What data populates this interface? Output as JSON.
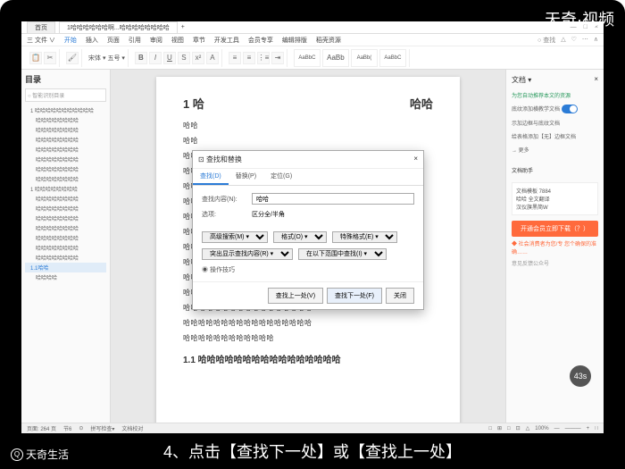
{
  "watermark": "天奇·视频",
  "titlebar": {
    "tab1": "首页",
    "tab2": "1哈哈哈哈哈哈啊...哈哈哈哈哈哈哈哈",
    "add": "+"
  },
  "window_controls": {
    "min": "—",
    "max": "□",
    "close": "×"
  },
  "ribbon": {
    "tabs": [
      "三 文件 ∨",
      "开始",
      "插入",
      "页面",
      "引用",
      "审阅",
      "视图",
      "章节",
      "开发工具",
      "会员专享",
      "编辑排版",
      "稻壳资源"
    ],
    "active_index": 1,
    "right": [
      "○ 查找",
      "△",
      "♡",
      "⋯",
      "∧"
    ]
  },
  "toolbar": {
    "styles": [
      "AaBbC",
      "AaBb(",
      "AaBbC"
    ],
    "style_big": "AaBb"
  },
  "sidebar": {
    "title": "目录",
    "search_placeholder": "智能识别目录",
    "items": [
      {
        "t": "1 哈哈哈哈哈哈哈哈哈哈哈",
        "lvl": 1
      },
      {
        "t": "哈哈哈哈哈哈哈哈",
        "lvl": 2
      },
      {
        "t": "哈哈哈哈哈哈哈哈",
        "lvl": 2
      },
      {
        "t": "哈哈哈哈哈哈哈哈",
        "lvl": 2
      },
      {
        "t": "哈哈哈哈哈哈哈哈",
        "lvl": 2
      },
      {
        "t": "哈哈哈哈哈哈哈哈",
        "lvl": 2
      },
      {
        "t": "哈哈哈哈哈哈哈哈",
        "lvl": 2
      },
      {
        "t": "哈哈哈哈哈哈哈哈",
        "lvl": 2
      },
      {
        "t": "1 哈哈哈哈哈哈哈哈",
        "lvl": 1
      },
      {
        "t": "哈哈哈哈哈哈哈哈",
        "lvl": 2
      },
      {
        "t": "哈哈哈哈哈哈哈哈",
        "lvl": 2
      },
      {
        "t": "哈哈哈哈哈哈哈哈",
        "lvl": 2
      },
      {
        "t": "哈哈哈哈哈哈哈哈",
        "lvl": 2
      },
      {
        "t": "哈哈哈哈哈哈哈哈",
        "lvl": 2
      },
      {
        "t": "哈哈哈哈哈哈哈哈",
        "lvl": 2
      },
      {
        "t": "哈哈哈哈哈哈哈哈",
        "lvl": 2
      },
      {
        "t": "1.1哈哈",
        "lvl": 1,
        "sel": true
      },
      {
        "t": "哈哈哈哈",
        "lvl": 2
      }
    ]
  },
  "document": {
    "h1": "1 哈",
    "h1_right": "哈哈",
    "paragraphs": [
      "哈哈",
      "哈哈",
      "哈哈哈",
      "哈哈哈",
      "哈哈哈",
      "哈哈",
      "哈哈",
      "哈哈哈哈哈哈哈哈哈哈哈哈哈哈哈哈哈",
      "哈哈哈哈哈哈哈哈哈哈哈哈哈哈哈哈哈",
      "哈哈哈哈哈哈哈哈哈哈哈哈",
      "哈哈哈哈哈哈哈哈哈哈哈哈哈哈哈 ∑4:",
      "哈哈哈哈哈哈哈哈哈哈哈哈哈哈哈哈哈",
      "哈哈哈哈哈哈哈哈哈哈哈哈哈哈哈哈哈",
      "哈哈哈哈哈哈哈哈哈哈哈哈哈哈哈哈哈",
      "哈哈哈哈哈哈哈哈哈哈哈哈"
    ],
    "h2": "1.1 哈哈哈哈哈哈哈哈哈哈哈哈哈哈哈哈"
  },
  "dialog": {
    "title": "查找和替换",
    "close": "×",
    "tabs": [
      "查找(D)",
      "替换(P)",
      "定位(G)"
    ],
    "active_tab": 0,
    "find_label": "查找内容(N):",
    "find_value": "哈哈",
    "options_label": "选项:",
    "options_value": "区分全/半角",
    "adv_buttons": [
      "高级搜索(M) ▾",
      "格式(O) ▾",
      "特殊格式(E) ▾"
    ],
    "highlight": "突出显示查找内容(R) ▾",
    "read_in": "在以下范围中查找(I) ▾",
    "footer_chk": "操作技巧",
    "buttons": {
      "prev": "查找上一处(V)",
      "next": "查找下一处(F)",
      "close": "关闭"
    }
  },
  "rightpane": {
    "title": "文档 ▾",
    "link1": "为您自动推荐本文的资源",
    "opt1": "底纹添加横教学文档",
    "opt2": "示加边框与底纹文档",
    "opt3": "给表格添加【无】边框文档",
    "more": "→ 更多",
    "section2": "文档助手",
    "card_items": [
      "文档模板 7884",
      "哈哈 全文翻译",
      "汉仪旗黑简W"
    ],
    "btn": "开通会员立即下载（？）",
    "note": "◆ 社会消费者为您/专 您个确保的准确……",
    "foot": "意见反馈公众号"
  },
  "statusbar": {
    "left": [
      "页面: 264 页",
      "节6",
      "⊙",
      "拼写检查▾",
      "文档校对"
    ],
    "right": [
      "□",
      "⊞",
      "□",
      "⊡",
      "△",
      "100%",
      "—",
      "———",
      "+",
      "∷"
    ]
  },
  "caption": "4、点击【查找下一处】或【查找上一处】",
  "logo_text": "天奇生活",
  "badge": "43s"
}
